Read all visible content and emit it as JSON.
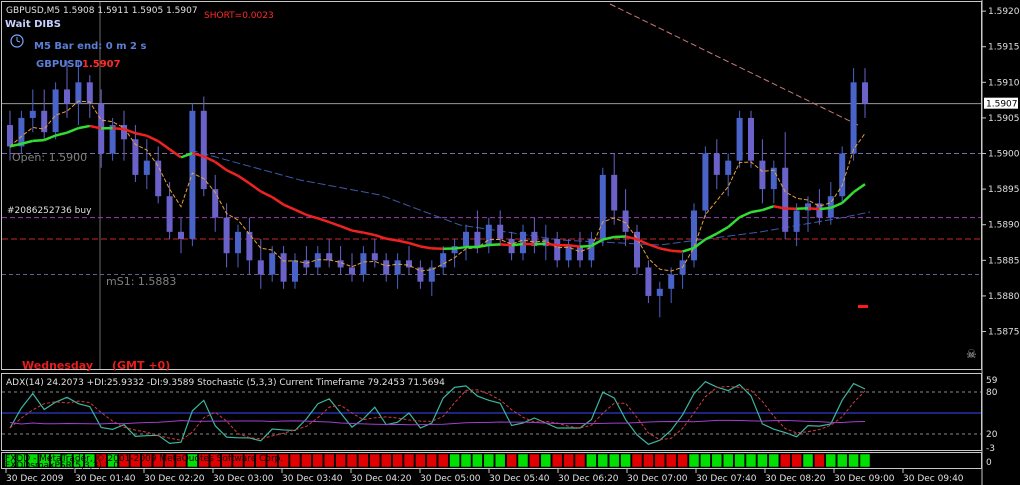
{
  "header": {
    "symbol_line": "GBPUSD,M5  1.5908 1.5911 1.5905 1.5907",
    "short_label": "SHORT=0.0023",
    "wait_label": "Wait DIBS",
    "bar_end_label": "M5 Bar end: 0 m 2 s",
    "pair_label": "GBPUSD",
    "pair_price": "1.5907"
  },
  "annotations": {
    "open_label": "Open: 1.5900",
    "ms1_label": "mS1: 1.5883",
    "order_label": "#2086252736 buy",
    "day_label": "Wednesday",
    "gmt_label": "(GMT +0)"
  },
  "price_axis": {
    "ticks": [
      "1.5920",
      "1.5915",
      "1.5910",
      "1.5905",
      "1.5900",
      "1.5895",
      "1.5890",
      "1.5885",
      "1.5880",
      "1.5875"
    ],
    "current": "1.5907"
  },
  "indicator": {
    "label": "ADX(14) 24.2073 +DI:25.9332 -DI:9.3589  Stochastic (5,3,3) Current Timeframe 79.2453 71.5694",
    "axis_ticks": [
      "59",
      "80",
      "20",
      "-3"
    ],
    "copyright": "FXDD - MetaTrader, © 2001-2009 MetaQuotes Software Corp.",
    "subtitle": "FXDDsmaxPSR(5,3,3) 1.0"
  },
  "bottom_indicator_axis": "0",
  "time_axis": [
    "30 Dec 2009",
    "30 Dec 01:40",
    "30 Dec 02:20",
    "30 Dec 03:00",
    "30 Dec 03:40",
    "30 Dec 04:20",
    "30 Dec 05:00",
    "30 Dec 05:40",
    "30 Dec 06:20",
    "30 Dec 07:00",
    "30 Dec 07:40",
    "30 Dec 08:20",
    "30 Dec 09:00",
    "30 Dec 09:40"
  ],
  "colors": {
    "bull": "#4a63c8",
    "bear": "#6a62c9",
    "ma_up": "#33dd33",
    "ma_down": "#ee2222",
    "grid": "#7a6aa8"
  },
  "chart_data": {
    "type": "candlestick",
    "price_range": [
      1.5871,
      1.5921
    ],
    "current_price": 1.5907,
    "levels": {
      "open": 1.59,
      "ms1": 1.5883,
      "order": 1.5891,
      "short_level": 1.5888
    },
    "candles": [
      [
        1.5904,
        1.5906,
        1.5899,
        1.5901
      ],
      [
        1.5901,
        1.5906,
        1.59,
        1.5905
      ],
      [
        1.5905,
        1.5909,
        1.5903,
        1.5906
      ],
      [
        1.5906,
        1.5909,
        1.5902,
        1.5903
      ],
      [
        1.5903,
        1.591,
        1.5902,
        1.5909
      ],
      [
        1.5909,
        1.5913,
        1.5905,
        1.5907
      ],
      [
        1.5907,
        1.5913,
        1.5904,
        1.591
      ],
      [
        1.591,
        1.5911,
        1.5905,
        1.5907
      ],
      [
        1.5907,
        1.5909,
        1.5898,
        1.59
      ],
      [
        1.59,
        1.5905,
        1.5899,
        1.5904
      ],
      [
        1.5904,
        1.5906,
        1.5899,
        1.5902
      ],
      [
        1.5902,
        1.5904,
        1.5896,
        1.5897
      ],
      [
        1.5897,
        1.5902,
        1.5895,
        1.5899
      ],
      [
        1.5899,
        1.5901,
        1.5893,
        1.5894
      ],
      [
        1.5894,
        1.5896,
        1.5888,
        1.5889
      ],
      [
        1.5889,
        1.5891,
        1.5886,
        1.5888
      ],
      [
        1.5888,
        1.5907,
        1.5887,
        1.5906
      ],
      [
        1.5906,
        1.5908,
        1.5894,
        1.5895
      ],
      [
        1.5895,
        1.5897,
        1.5889,
        1.5891
      ],
      [
        1.5891,
        1.5893,
        1.5884,
        1.5886
      ],
      [
        1.5886,
        1.589,
        1.5884,
        1.5889
      ],
      [
        1.5889,
        1.5891,
        1.5883,
        1.5885
      ],
      [
        1.5885,
        1.5888,
        1.5881,
        1.5883
      ],
      [
        1.5883,
        1.5887,
        1.5882,
        1.5886
      ],
      [
        1.5886,
        1.5887,
        1.5881,
        1.5882
      ],
      [
        1.5882,
        1.5886,
        1.5881,
        1.5885
      ],
      [
        1.5885,
        1.5887,
        1.5883,
        1.5884
      ],
      [
        1.5884,
        1.5887,
        1.5883,
        1.5886
      ],
      [
        1.5886,
        1.5888,
        1.5884,
        1.5885
      ],
      [
        1.5885,
        1.5887,
        1.5883,
        1.5884
      ],
      [
        1.5884,
        1.5886,
        1.5882,
        1.5883
      ],
      [
        1.5883,
        1.5887,
        1.5882,
        1.5886
      ],
      [
        1.5886,
        1.5888,
        1.5884,
        1.5885
      ],
      [
        1.5885,
        1.5886,
        1.5882,
        1.5883
      ],
      [
        1.5883,
        1.5886,
        1.5881,
        1.5885
      ],
      [
        1.5885,
        1.5887,
        1.5883,
        1.5884
      ],
      [
        1.5884,
        1.5885,
        1.5881,
        1.5882
      ],
      [
        1.5882,
        1.5885,
        1.588,
        1.5884
      ],
      [
        1.5884,
        1.5887,
        1.5883,
        1.5886
      ],
      [
        1.5886,
        1.5888,
        1.5884,
        1.5887
      ],
      [
        1.5887,
        1.589,
        1.5885,
        1.5889
      ],
      [
        1.5889,
        1.5892,
        1.5886,
        1.5887
      ],
      [
        1.5887,
        1.5891,
        1.5886,
        1.589
      ],
      [
        1.589,
        1.5892,
        1.5887,
        1.5888
      ],
      [
        1.5888,
        1.5889,
        1.5885,
        1.5886
      ],
      [
        1.5886,
        1.589,
        1.5885,
        1.5889
      ],
      [
        1.5889,
        1.5891,
        1.5886,
        1.5887
      ],
      [
        1.5887,
        1.589,
        1.5885,
        1.5888
      ],
      [
        1.5888,
        1.5889,
        1.5884,
        1.5885
      ],
      [
        1.5885,
        1.5888,
        1.5884,
        1.5887
      ],
      [
        1.5887,
        1.5889,
        1.5884,
        1.5885
      ],
      [
        1.5885,
        1.5889,
        1.5884,
        1.5888
      ],
      [
        1.5888,
        1.5898,
        1.5887,
        1.5897
      ],
      [
        1.5897,
        1.59,
        1.589,
        1.5892
      ],
      [
        1.5892,
        1.5895,
        1.5887,
        1.5889
      ],
      [
        1.5889,
        1.589,
        1.5883,
        1.5884
      ],
      [
        1.5884,
        1.5885,
        1.5879,
        1.588
      ],
      [
        1.588,
        1.5882,
        1.5877,
        1.5881
      ],
      [
        1.5881,
        1.5884,
        1.5879,
        1.5883
      ],
      [
        1.5883,
        1.5886,
        1.5881,
        1.5885
      ],
      [
        1.5885,
        1.5893,
        1.5884,
        1.5892
      ],
      [
        1.5892,
        1.5901,
        1.5891,
        1.59
      ],
      [
        1.59,
        1.5902,
        1.5895,
        1.5897
      ],
      [
        1.5897,
        1.59,
        1.5894,
        1.5899
      ],
      [
        1.5899,
        1.5906,
        1.5898,
        1.5905
      ],
      [
        1.5905,
        1.5906,
        1.5898,
        1.5899
      ],
      [
        1.5899,
        1.5902,
        1.5893,
        1.5895
      ],
      [
        1.5895,
        1.5899,
        1.5893,
        1.5898
      ],
      [
        1.5898,
        1.5903,
        1.5888,
        1.5889
      ],
      [
        1.5889,
        1.5893,
        1.5887,
        1.5892
      ],
      [
        1.5892,
        1.5894,
        1.5889,
        1.5893
      ],
      [
        1.5893,
        1.5895,
        1.589,
        1.5891
      ],
      [
        1.5891,
        1.5896,
        1.589,
        1.5894
      ],
      [
        1.5894,
        1.5901,
        1.5893,
        1.59
      ],
      [
        1.59,
        1.5912,
        1.5899,
        1.591
      ],
      [
        1.591,
        1.5912,
        1.5905,
        1.5907
      ]
    ]
  }
}
